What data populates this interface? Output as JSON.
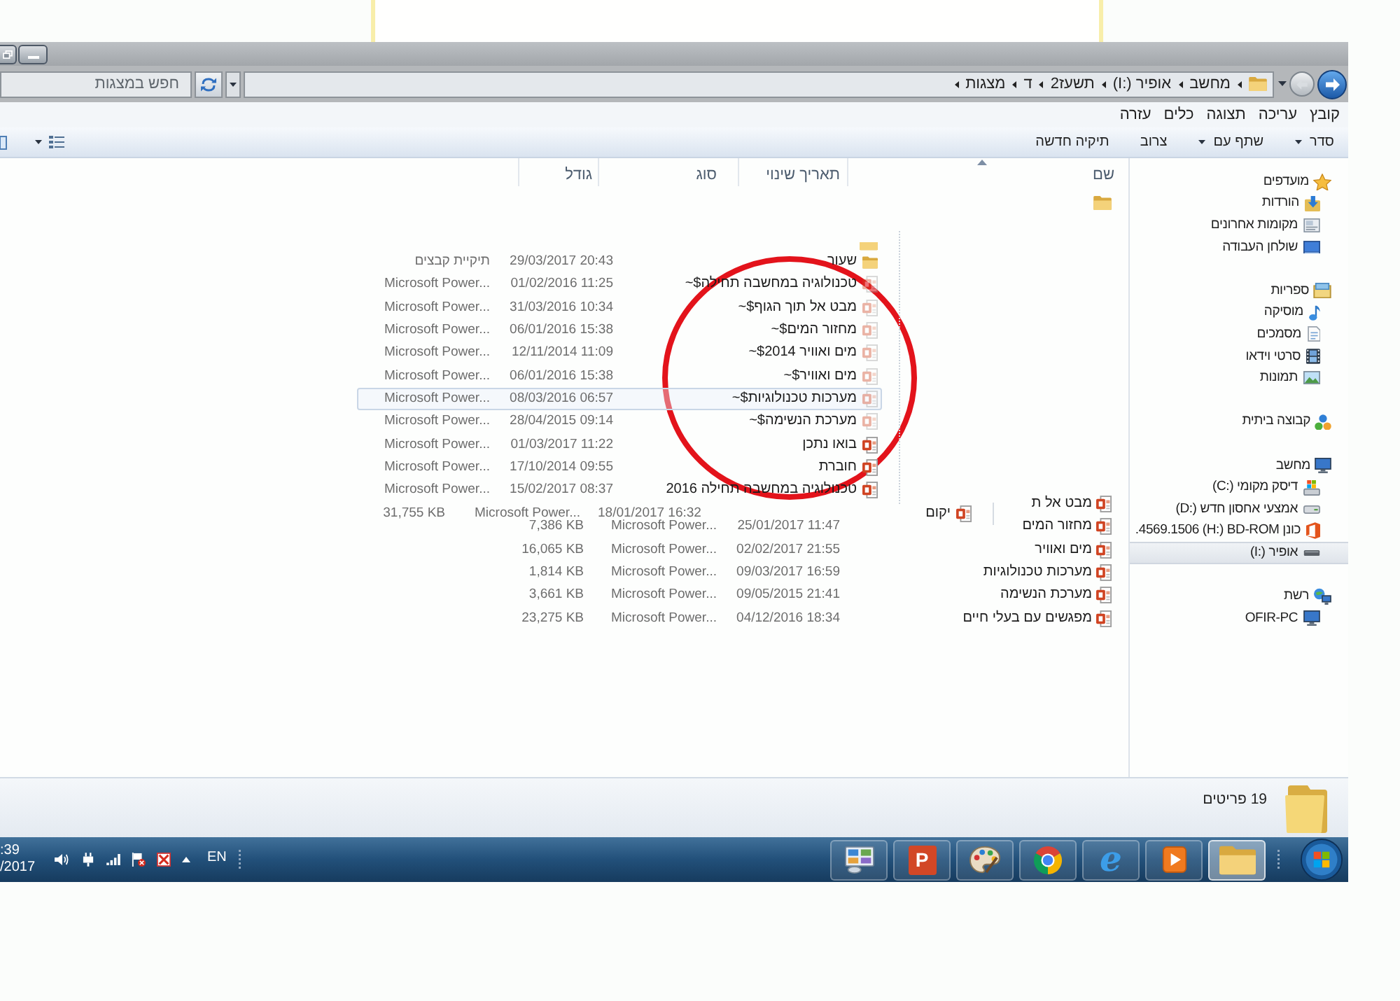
{
  "address_bar": {
    "path": [
      {
        "label": "מחשב"
      },
      {
        "label": "אופיר",
        "drive": "(I:)"
      },
      {
        "label": "תשעז2"
      },
      {
        "label": "ד"
      },
      {
        "label": "מצגות"
      }
    ],
    "search": {
      "placeholder": "חפש במצגות"
    }
  },
  "menu": [
    "קובץ",
    "עריכה",
    "תצוגה",
    "כלים",
    "עזרה"
  ],
  "toolbar": [
    {
      "label": "סדר",
      "dropdown": true
    },
    {
      "label": "שתף עם",
      "dropdown": true
    },
    {
      "label": "צרוב",
      "dropdown": false
    },
    {
      "label": "תיקיה חדשה",
      "dropdown": false
    }
  ],
  "columns": [
    {
      "label": "שם",
      "sorted": true
    },
    {
      "label": "תאריך שינוי",
      "sorted": false
    },
    {
      "label": "סוג",
      "sorted": false
    },
    {
      "label": "גודל",
      "sorted": false
    }
  ],
  "overlay_list": [
    {
      "name": "שעור",
      "date": "29/03/2017 20:43",
      "type": "תיקיית קבצים",
      "kind": "folder",
      "hidden": false,
      "selected": false
    },
    {
      "name": "~$טכנולוגיה במחשבה תחילה",
      "date": "01/02/2016 11:25",
      "type": "Microsoft Power...",
      "kind": "presentation",
      "hidden": true,
      "selected": false
    },
    {
      "name": "~$מבט אל תוך הגוף",
      "date": "31/03/2016 10:34",
      "type": "Microsoft Power...",
      "kind": "presentation",
      "hidden": true,
      "selected": false
    },
    {
      "name": "~$מחזור המים",
      "date": "06/01/2016 15:38",
      "type": "Microsoft Power...",
      "kind": "presentation",
      "hidden": true,
      "selected": false
    },
    {
      "name": "~$מים ואוויר 2014",
      "date": "12/11/2014 11:09",
      "type": "Microsoft Power...",
      "kind": "presentation",
      "hidden": true,
      "selected": false
    },
    {
      "name": "~$מים ואוויר",
      "date": "06/01/2016 15:38",
      "type": "Microsoft Power...",
      "kind": "presentation",
      "hidden": true,
      "selected": false
    },
    {
      "name": "~$מערכות טכנולוגיות",
      "date": "08/03/2016 06:57",
      "type": "Microsoft Power...",
      "kind": "presentation",
      "hidden": true,
      "selected": true
    },
    {
      "name": "~$מערכת הנשימה",
      "date": "28/04/2015 09:14",
      "type": "Microsoft Power...",
      "kind": "presentation",
      "hidden": true,
      "selected": false
    },
    {
      "name": "בואו נתכן",
      "date": "01/03/2017 11:22",
      "type": "Microsoft Power...",
      "kind": "presentation",
      "hidden": false,
      "selected": false
    },
    {
      "name": "חוברת",
      "date": "17/10/2014 09:55",
      "type": "Microsoft Power...",
      "kind": "presentation",
      "hidden": false,
      "selected": false
    },
    {
      "name": "טכנולוגיה במחשבה תחילה 2016",
      "date": "15/02/2017 08:37",
      "type": "Microsoft Power...",
      "kind": "presentation",
      "hidden": false,
      "selected": false
    }
  ],
  "misplaced_row": {
    "name": "יקום",
    "date": "18/01/2017 16:32",
    "type": "Microsoft Power...",
    "size": "31,755 KB",
    "kind": "presentation"
  },
  "files": [
    {
      "name": "מבט אל ת",
      "kind": "presentation",
      "selected": false
    },
    {
      "name": "מחזור המים",
      "date": "25/01/2017 11:47",
      "type": "Microsoft Power...",
      "size": "7,386 KB",
      "kind": "presentation",
      "selected": false
    },
    {
      "name": "מים ואוויר",
      "date": "02/02/2017 21:55",
      "type": "Microsoft Power...",
      "size": "16,065 KB",
      "kind": "presentation",
      "selected": false
    },
    {
      "name": "מערכות טכנולוגיות",
      "date": "09/03/2017 16:59",
      "type": "Microsoft Power...",
      "size": "1,814 KB",
      "kind": "presentation",
      "selected": false
    },
    {
      "name": "מערכת הנשימה",
      "date": "09/05/2015 21:41",
      "type": "Microsoft Power...",
      "size": "3,661 KB",
      "kind": "presentation",
      "selected": false
    },
    {
      "name": "מפגשים עם בעלי חיים",
      "date": "04/12/2016 18:34",
      "type": "Microsoft Power...",
      "size": "23,275 KB",
      "kind": "presentation",
      "selected": false
    }
  ],
  "navigation": [
    {
      "label": "מועדפים",
      "kind": "favorites",
      "selected": false,
      "children": [
        {
          "label": "הורדות",
          "kind": "downloads",
          "selected": false
        },
        {
          "label": "מקומות אחרונים",
          "kind": "recent",
          "selected": false
        },
        {
          "label": "שולחן העבודה",
          "kind": "desktop",
          "selected": false
        }
      ]
    },
    {
      "label": "ספריות",
      "kind": "libraries",
      "selected": false,
      "children": [
        {
          "label": "מוסיקה",
          "kind": "music",
          "selected": false
        },
        {
          "label": "מסמכים",
          "kind": "documents",
          "selected": false
        },
        {
          "label": "סרטי וידאו",
          "kind": "videos",
          "selected": false
        },
        {
          "label": "תמונות",
          "kind": "pictures",
          "selected": false
        }
      ]
    },
    {
      "label": "קבוצה ביתית",
      "kind": "homegroup",
      "selected": false
    },
    {
      "label": "מחשב",
      "kind": "computer",
      "selected": false,
      "children": [
        {
          "label": "דיסק מקומי",
          "drive": "(C:)",
          "kind": "sysdrive",
          "selected": false
        },
        {
          "label": "אמצעי אחסון חדש",
          "drive": "(D:)",
          "kind": "drive",
          "selected": false
        },
        {
          "label": "כונן BD-ROM",
          "drive": "(H:)",
          "suffix": ".4569.1506",
          "kind": "disc",
          "selected": false
        },
        {
          "label": "אופיר",
          "drive": "(I:)",
          "kind": "removable",
          "selected": true
        }
      ]
    },
    {
      "label": "רשת",
      "kind": "network",
      "selected": false,
      "children": [
        {
          "label": "OFIR-PC",
          "kind": "pc",
          "selected": false
        }
      ]
    }
  ],
  "details": {
    "count": "19 פריטים"
  },
  "taskbar": {
    "clock": {
      "time": ":39",
      "date": "/2017"
    },
    "language": "EN",
    "apps": [
      {
        "kind": "folder",
        "selected": true
      },
      {
        "kind": "player",
        "selected": false
      },
      {
        "kind": "browser",
        "glyph": "e",
        "selected": false
      },
      {
        "kind": "ring",
        "selected": false
      },
      {
        "kind": "palette",
        "selected": false
      },
      {
        "kind": "slides",
        "glyph": "P",
        "selected": false
      },
      {
        "kind": "panel",
        "selected": false
      }
    ]
  }
}
